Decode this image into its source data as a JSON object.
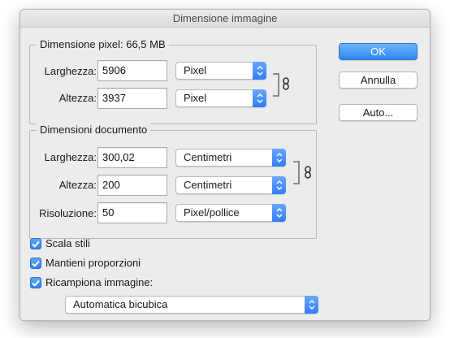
{
  "dialog": {
    "title": "Dimensione immagine"
  },
  "pixel_dims": {
    "legend": "Dimensione pixel:  66,5 MB",
    "width_label": "Larghezza:",
    "width_value": "5906",
    "width_unit": "Pixel",
    "height_label": "Altezza:",
    "height_value": "3937",
    "height_unit": "Pixel"
  },
  "doc_dims": {
    "legend": "Dimensioni documento",
    "width_label": "Larghezza:",
    "width_value": "300,02",
    "width_unit": "Centimetri",
    "height_label": "Altezza:",
    "height_value": "200",
    "height_unit": "Centimetri",
    "resolution_label": "Risoluzione:",
    "resolution_value": "50",
    "resolution_unit": "Pixel/pollice"
  },
  "options": {
    "scale_styles": {
      "label": "Scala stili",
      "checked": true
    },
    "constrain": {
      "label": "Mantieni proporzioni",
      "checked": true
    },
    "resample": {
      "label": "Ricampiona immagine:",
      "checked": true
    },
    "resample_method": "Automatica bicubica"
  },
  "buttons": {
    "ok": "OK",
    "cancel": "Annulla",
    "auto": "Auto..."
  },
  "colors": {
    "accent": "#2f80f4",
    "window_bg": "#ececec"
  }
}
